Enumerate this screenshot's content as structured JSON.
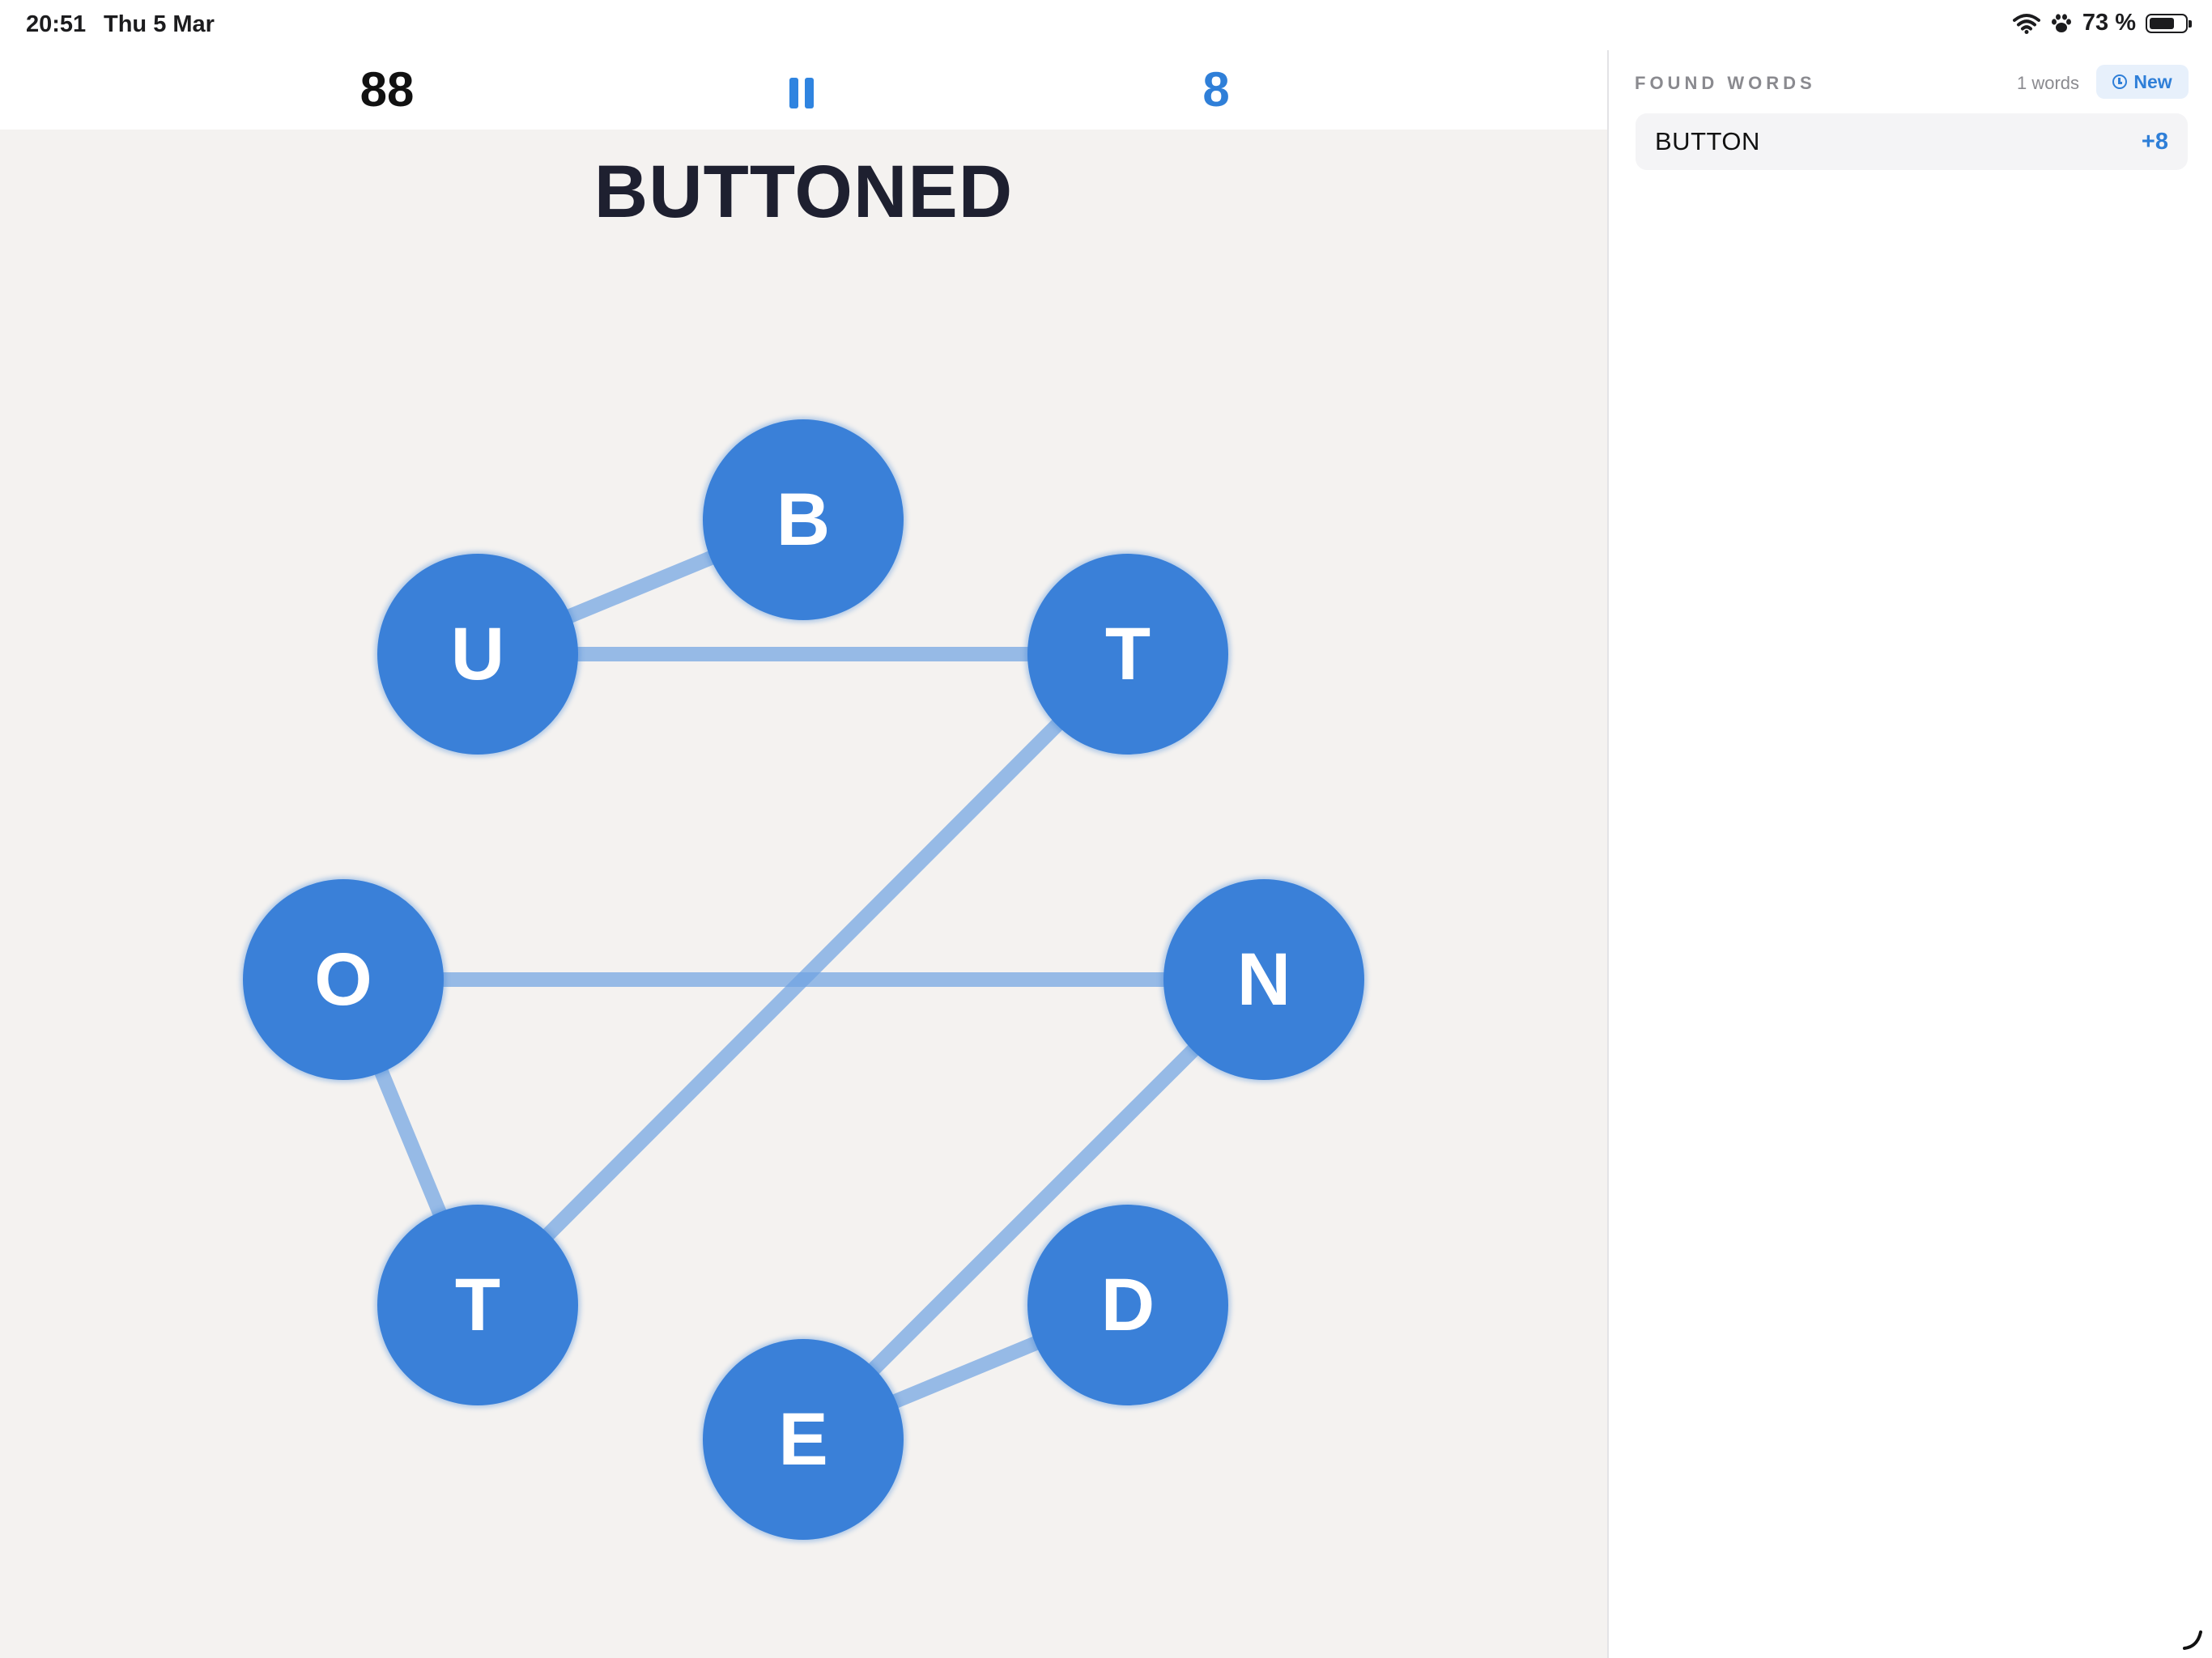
{
  "status_bar": {
    "time": "20:51",
    "date": "Thu 5 Mar",
    "battery_text": "73 %",
    "battery_level": 0.73,
    "icons": [
      "wifi-icon",
      "paw-icon",
      "battery-icon"
    ]
  },
  "game": {
    "score": "88",
    "word_count": "8",
    "current_word": "BUTTONED",
    "pause_icon": "pause-icon",
    "colors": {
      "accent": "#3a80d8",
      "board_bg": "#f4f2f0",
      "line": "#6fa3e3"
    },
    "nodes": [
      {
        "id": "b",
        "letter": "B"
      },
      {
        "id": "u",
        "letter": "U"
      },
      {
        "id": "t1",
        "letter": "T"
      },
      {
        "id": "o",
        "letter": "O"
      },
      {
        "id": "n",
        "letter": "N"
      },
      {
        "id": "t2",
        "letter": "T"
      },
      {
        "id": "e",
        "letter": "E"
      },
      {
        "id": "d",
        "letter": "D"
      }
    ],
    "path": [
      "b",
      "u",
      "t1",
      "t2",
      "o",
      "n",
      "e",
      "d"
    ]
  },
  "panel": {
    "title": "FOUND WORDS",
    "count_text": "1 words",
    "new_label": "New",
    "new_icon": "clock-icon",
    "words": [
      {
        "word": "BUTTON",
        "points": "+8"
      }
    ]
  }
}
